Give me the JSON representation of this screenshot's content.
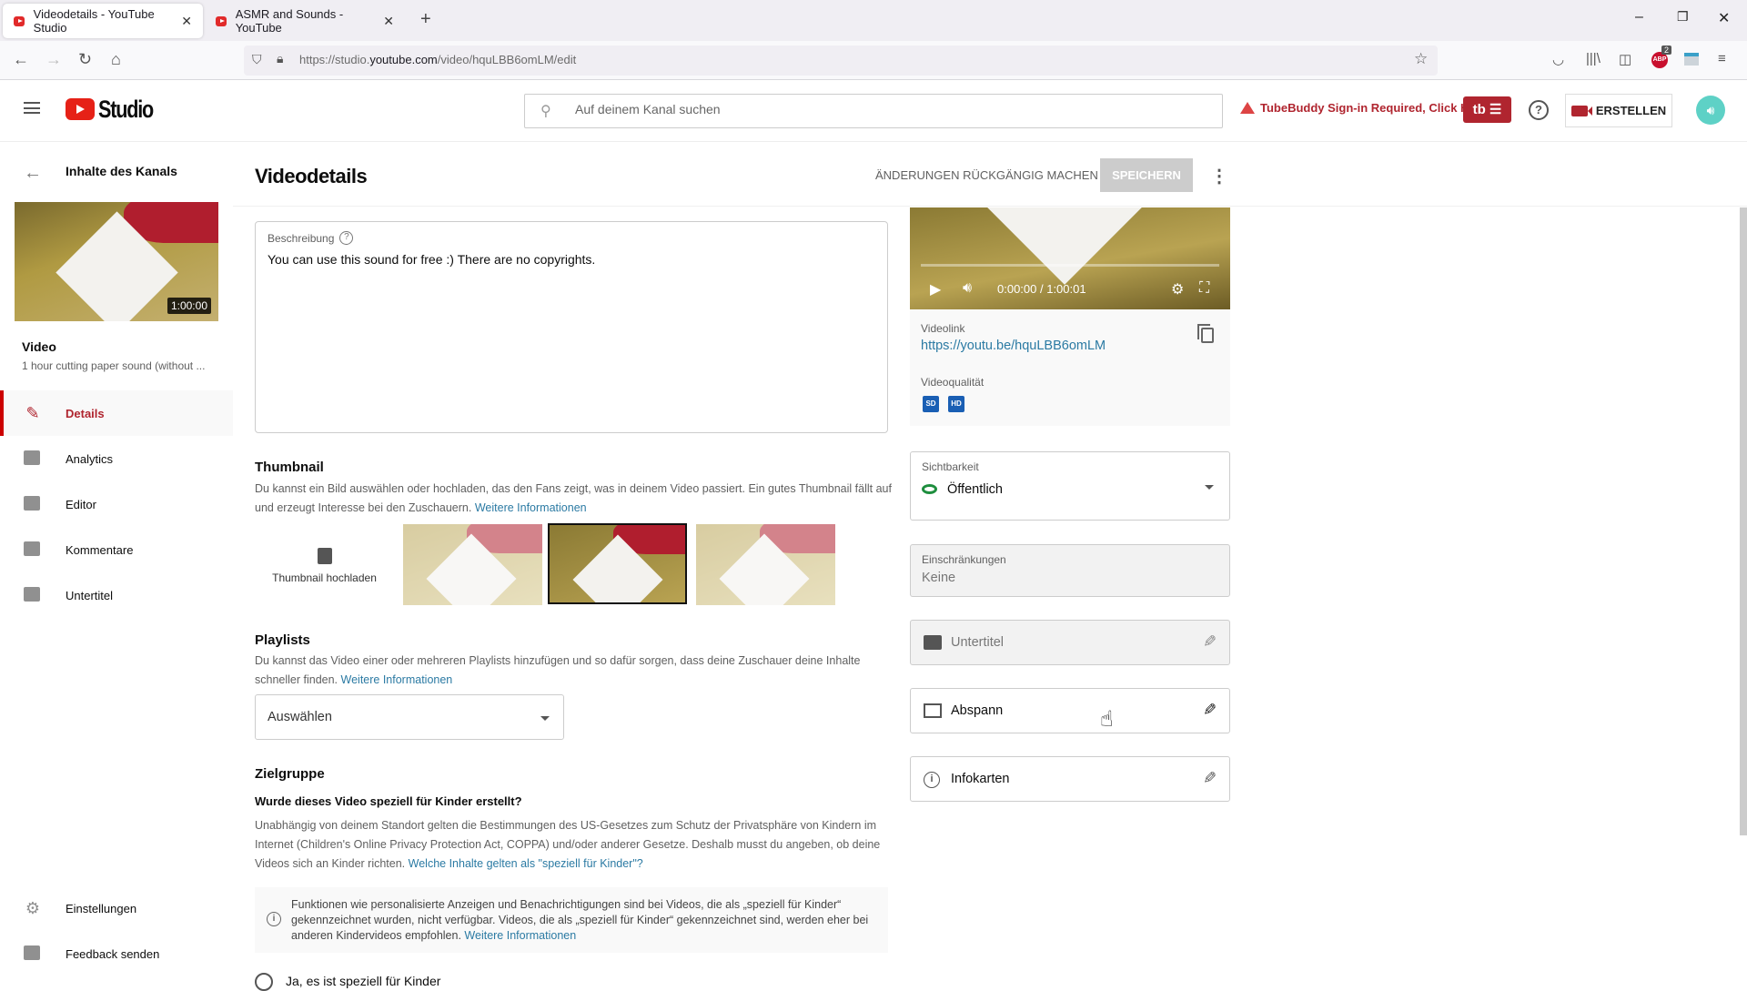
{
  "browser": {
    "tabs": [
      {
        "title": "Videodetails - YouTube Studio",
        "active": true
      },
      {
        "title": "ASMR and Sounds - YouTube",
        "active": false
      }
    ],
    "url_prefix": "https://studio.",
    "url_domain": "youtube.com",
    "url_path": "/video/hquLBB6omLM/edit",
    "abp_badge": "2"
  },
  "header": {
    "logo_text": "Studio",
    "search_placeholder": "Auf deinem Kanal suchen",
    "tubebuddy_warning": "TubeBuddy Sign-in Required, Click Here",
    "tubebuddy_button": "tb ☰",
    "help": "?",
    "create_label": "ERSTELLEN"
  },
  "sidebar": {
    "back_label": "Inhalte des Kanals",
    "video_duration": "1:00:00",
    "video_heading": "Video",
    "video_title": "1 hour cutting paper sound (without ...",
    "items": [
      {
        "label": "Details",
        "icon": "pencil-icon",
        "active": true
      },
      {
        "label": "Analytics",
        "icon": "analytics-icon",
        "active": false
      },
      {
        "label": "Editor",
        "icon": "clapperboard-icon",
        "active": false
      },
      {
        "label": "Kommentare",
        "icon": "comment-icon",
        "active": false
      },
      {
        "label": "Untertitel",
        "icon": "subtitles-icon",
        "active": false
      }
    ],
    "bottom_items": [
      {
        "label": "Einstellungen",
        "icon": "gear-icon"
      },
      {
        "label": "Feedback senden",
        "icon": "feedback-icon"
      }
    ]
  },
  "main": {
    "title": "Videodetails",
    "undo_label": "ÄNDERUNGEN RÜCKGÄNGIG MACHEN",
    "save_label": "SPEICHERN",
    "description": {
      "label": "Beschreibung",
      "value": "You can use this sound for free :) There are no copyrights."
    },
    "thumbnail": {
      "heading": "Thumbnail",
      "text": "Du kannst ein Bild auswählen oder hochladen, das den Fans zeigt, was in deinem Video passiert. Ein gutes Thumbnail fällt auf und erzeugt Interesse bei den Zuschauern.",
      "link": "Weitere Informationen",
      "upload_label": "Thumbnail hochladen",
      "selected_index": 1
    },
    "playlists": {
      "heading": "Playlists",
      "text": "Du kannst das Video einer oder mehreren Playlists hinzufügen und so dafür sorgen, dass deine Zuschauer deine Inhalte schneller finden.",
      "link": "Weitere Informationen",
      "select_value": "Auswählen"
    },
    "audience": {
      "heading": "Zielgruppe",
      "question": "Wurde dieses Video speziell für Kinder erstellt?",
      "text": "Unabhängig von deinem Standort gelten die Bestimmungen des US-Gesetzes zum Schutz der Privatsphäre von Kindern im Internet (Children's Online Privacy Protection Act, COPPA) und/oder anderer Gesetze. Deshalb musst du angeben, ob deine Videos sich an Kinder richten.",
      "link": "Welche Inhalte gelten als \"speziell für Kinder\"?",
      "info": "Funktionen wie personalisierte Anzeigen und Benachrichtigungen sind bei Videos, die als „speziell für Kinder“ gekennzeichnet wurden, nicht verfügbar. Videos, die als „speziell für Kinder“ gekennzeichnet sind, werden eher bei anderen Kindervideos empfohlen.",
      "info_link": "Weitere Informationen",
      "radio_yes": "Ja, es ist speziell für Kinder"
    }
  },
  "right": {
    "player_time": "0:00:00 / 1:00:01",
    "videolink_label": "Videolink",
    "videolink": "https://youtu.be/hquLBB6omLM",
    "quality_label": "Videoqualität",
    "quality_badges": [
      "SD",
      "HD"
    ],
    "visibility_label": "Sichtbarkeit",
    "visibility_value": "Öffentlich",
    "restrictions_label": "Einschränkungen",
    "restrictions_value": "Keine",
    "subtitles_label": "Untertitel",
    "endscreen_label": "Abspann",
    "cards_label": "Infokarten",
    "colors": {
      "accent": "#b0252f",
      "link": "#2b7aa3",
      "visibility_green": "#1e8e3e"
    }
  }
}
